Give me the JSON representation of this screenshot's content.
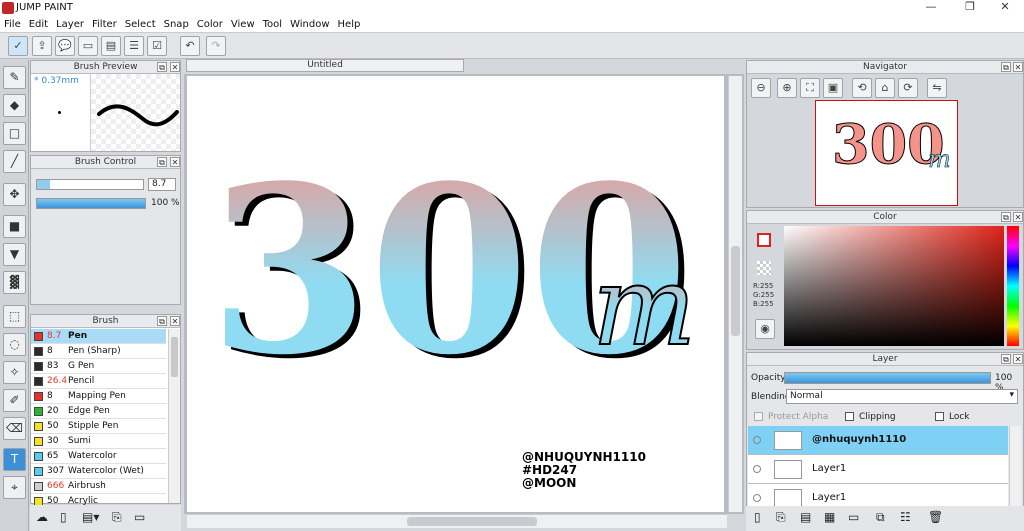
{
  "app": {
    "title": "JUMP PAINT",
    "min": "—",
    "max": "❐",
    "close": "✕"
  },
  "menu": [
    "File",
    "Edit",
    "Layer",
    "Filter",
    "Select",
    "Snap",
    "Color",
    "View",
    "Tool",
    "Window",
    "Help"
  ],
  "canvas": {
    "tab": "Untitled",
    "art_number": "300",
    "art_unit": "m",
    "credits": [
      "@NHUQUYNH1110",
      "#HD247",
      "@MOON"
    ]
  },
  "brush_preview": {
    "title": "Brush Preview",
    "size": "* 0.37mm"
  },
  "brush_control": {
    "title": "Brush Control",
    "size_value": "8.7",
    "opacity_value": "100 %",
    "size_fill": 0.12,
    "opacity_fill": 1.0
  },
  "brush": {
    "title": "Brush",
    "items": [
      {
        "size": "8.7",
        "name": "Pen",
        "color": "#e8302a",
        "size_red": true,
        "selected": true
      },
      {
        "size": "8",
        "name": "Pen (Sharp)",
        "color": "#2b2b2b",
        "size_red": false,
        "selected": false
      },
      {
        "size": "83",
        "name": "G Pen",
        "color": "#2b2b2b",
        "size_red": false,
        "selected": false
      },
      {
        "size": "26.4",
        "name": "Pencil",
        "color": "#2b2b2b",
        "size_red": true,
        "selected": false
      },
      {
        "size": "8",
        "name": "Mapping Pen",
        "color": "#e8302a",
        "size_red": false,
        "selected": false
      },
      {
        "size": "20",
        "name": "Edge Pen",
        "color": "#2bb52b",
        "size_red": false,
        "selected": false
      },
      {
        "size": "50",
        "name": "Stipple Pen",
        "color": "#f2e32a",
        "size_red": false,
        "selected": false
      },
      {
        "size": "30",
        "name": "Sumi",
        "color": "#f2e32a",
        "size_red": false,
        "selected": false
      },
      {
        "size": "65",
        "name": "Watercolor",
        "color": "#5ec8f0",
        "size_red": false,
        "selected": false
      },
      {
        "size": "307",
        "name": "Watercolor (Wet)",
        "color": "#5ec8f0",
        "size_red": false,
        "selected": false
      },
      {
        "size": "666",
        "name": "Airbrush",
        "color": "#cfcfcf",
        "size_red": true,
        "selected": false
      },
      {
        "size": "50",
        "name": "Acrylic",
        "color": "#f2e32a",
        "size_red": false,
        "selected": false
      }
    ]
  },
  "navigator": {
    "title": "Navigator"
  },
  "color": {
    "title": "Color",
    "r": "R:255",
    "g": "G:255",
    "b": "B:255"
  },
  "layer": {
    "title": "Layer",
    "opacity_label": "Opacity",
    "opacity_value": "100 %",
    "blending_label": "Blending",
    "blending_value": "Normal",
    "protect_alpha": "Protect Alpha",
    "clipping": "Clipping",
    "lock": "Lock",
    "layers": [
      {
        "name": "@nhuquynh1110",
        "selected": true
      },
      {
        "name": "Layer1",
        "selected": false
      },
      {
        "name": "Layer1",
        "selected": false
      }
    ]
  },
  "colors": {
    "accent": "#3d8fd6",
    "selected_row": "#7fd0f5",
    "pink": "#f4938a",
    "blue": "#8fdcf2"
  }
}
